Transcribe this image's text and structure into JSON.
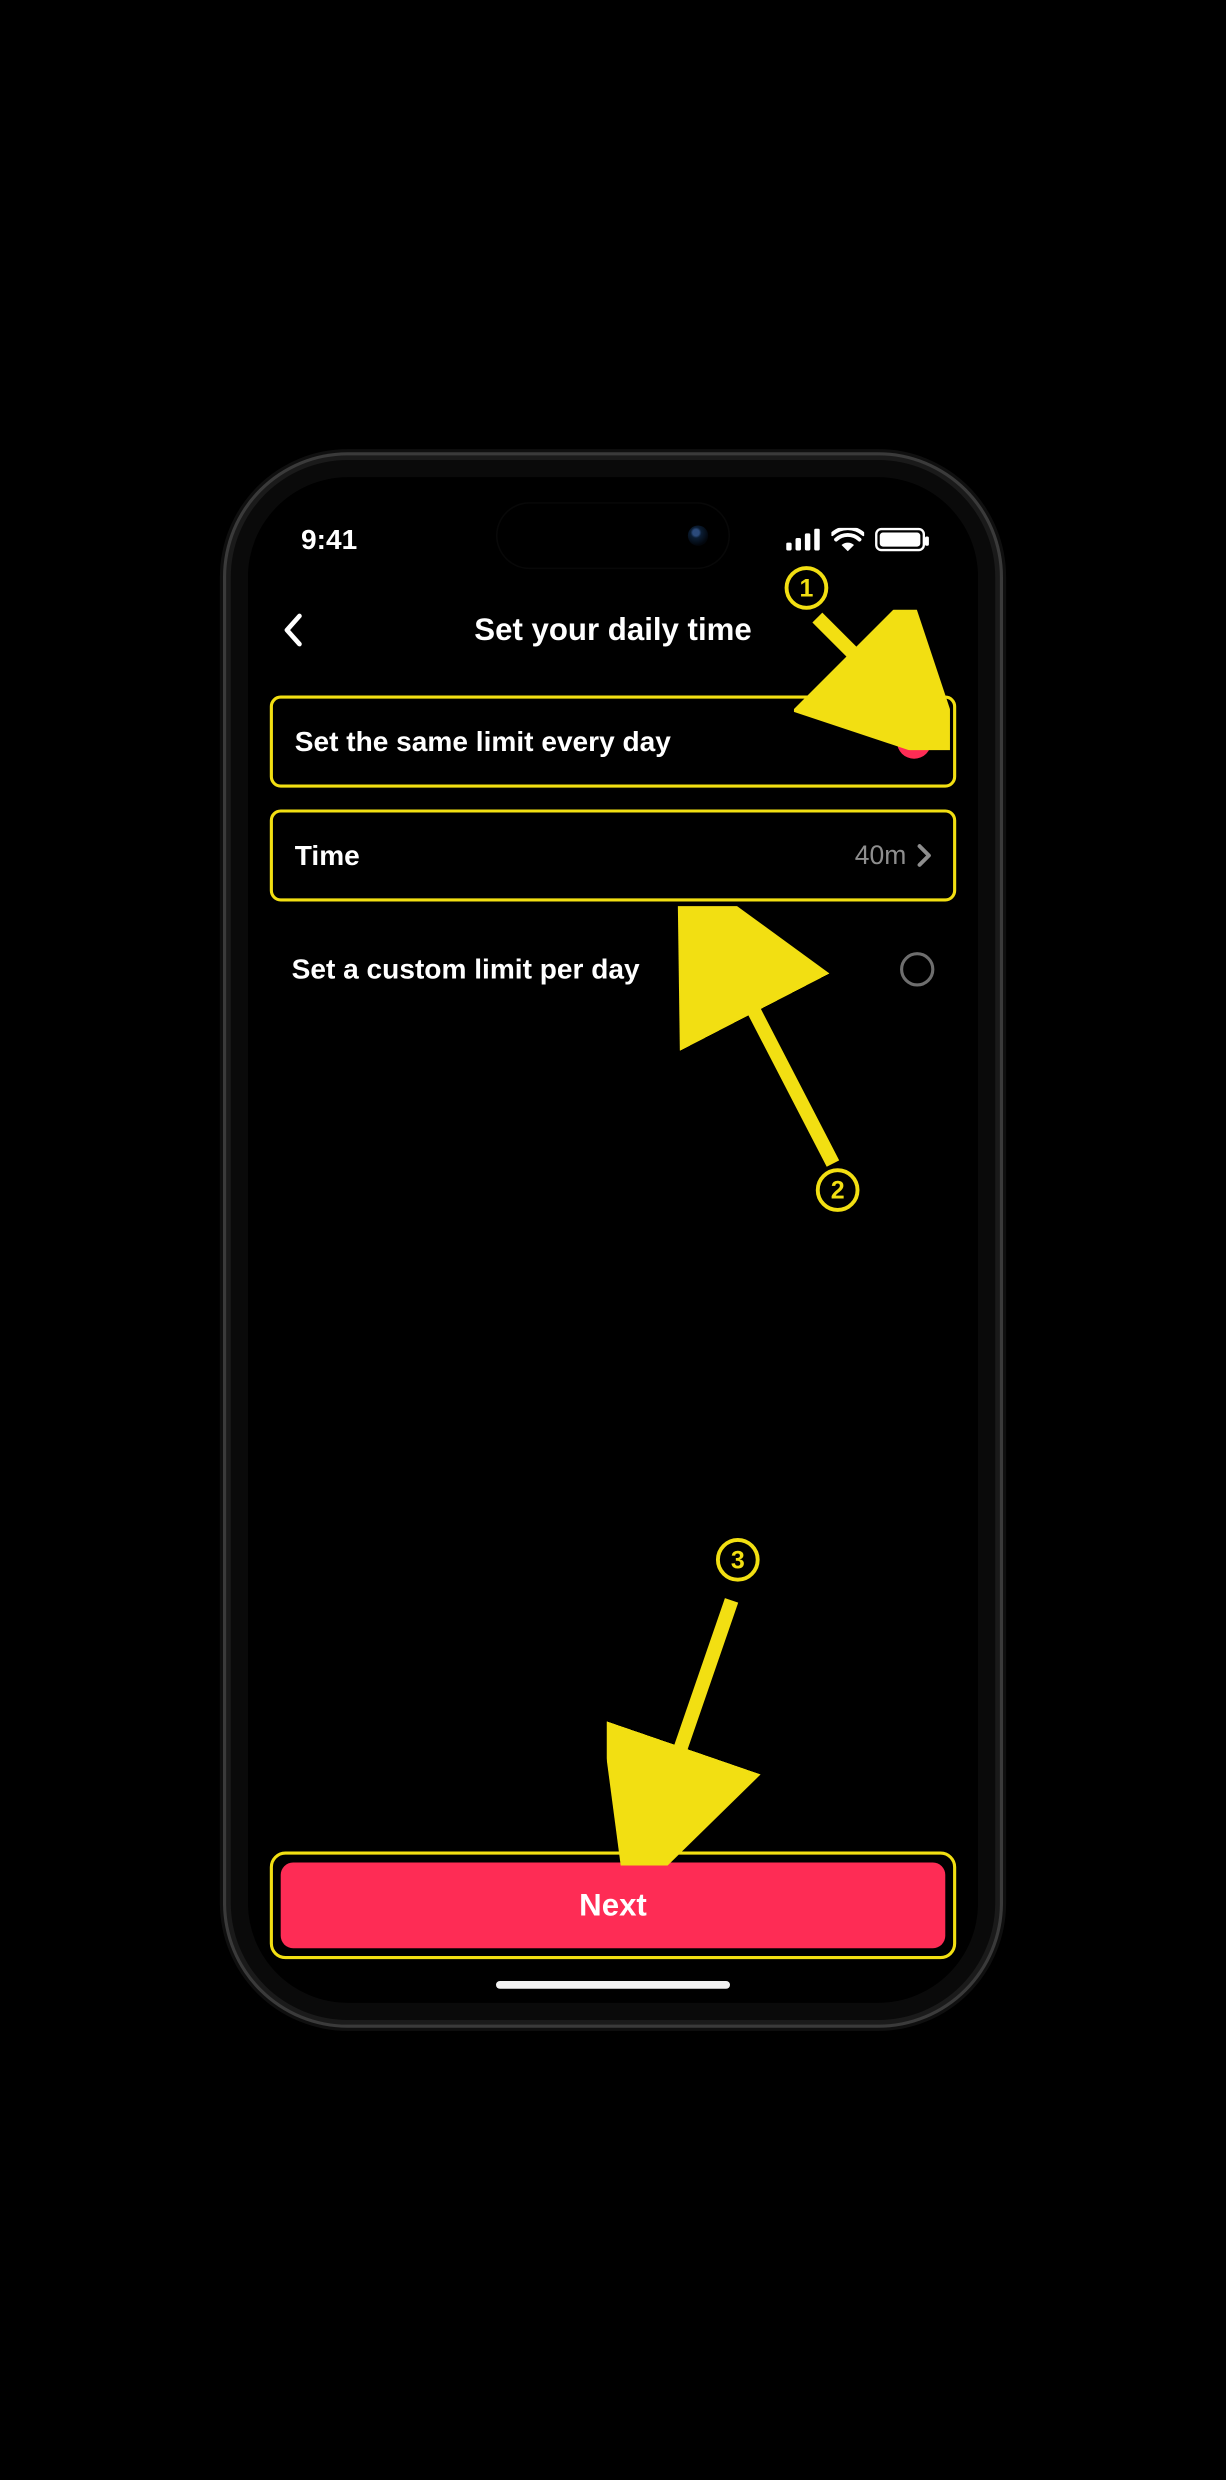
{
  "status": {
    "time": "9:41"
  },
  "header": {
    "title": "Set your daily time"
  },
  "rows": {
    "same": {
      "label": "Set the same limit every day"
    },
    "time": {
      "label": "Time",
      "value": "40m"
    },
    "custom": {
      "label": "Set a custom limit per day"
    }
  },
  "footer": {
    "next_label": "Next"
  },
  "annotations": {
    "n1": "1",
    "n2": "2",
    "n3": "3"
  },
  "colors": {
    "accent": "#fe2c55",
    "highlight": "#f2df12"
  }
}
